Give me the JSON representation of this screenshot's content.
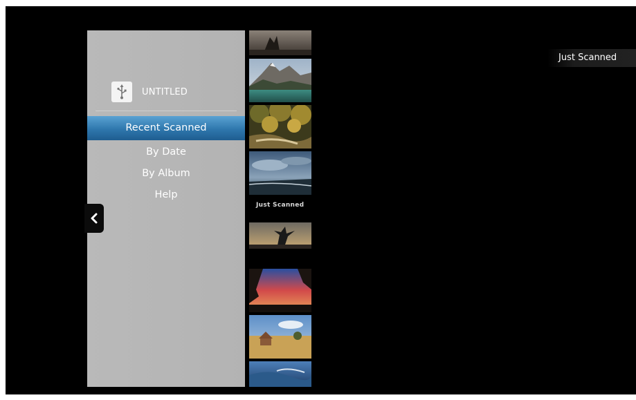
{
  "source": {
    "name": "UNTITLED",
    "icon": "usb-icon"
  },
  "menu": {
    "items": [
      {
        "label": "Recent Scanned",
        "selected": true
      },
      {
        "label": "By Date",
        "selected": false
      },
      {
        "label": "By Album",
        "selected": false
      },
      {
        "label": "Help",
        "selected": false
      }
    ]
  },
  "strip": {
    "group_label": "Just Scanned"
  },
  "header": {
    "current_view": "Just Scanned"
  },
  "colors": {
    "selection_blue": "#2e77ad",
    "sidebar_gray": "#b7b7b7",
    "background": "#000000"
  }
}
